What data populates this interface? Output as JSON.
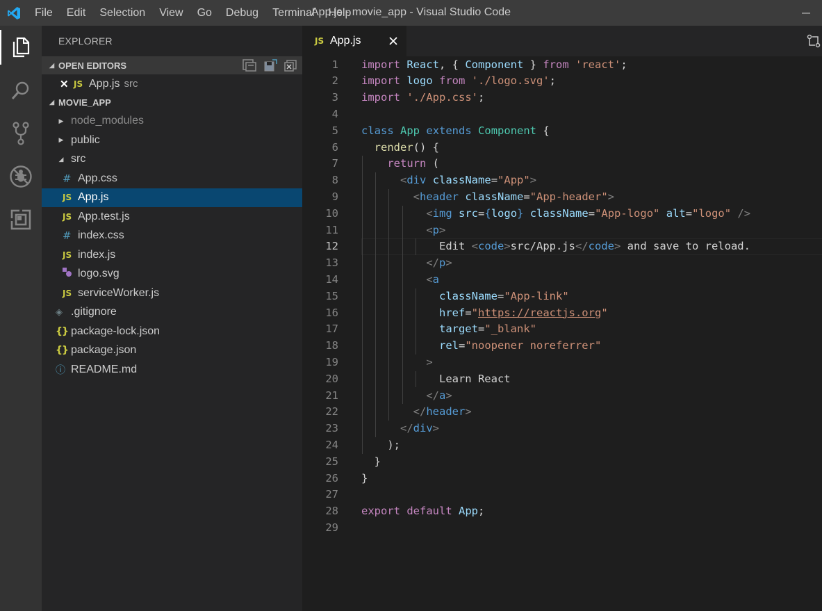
{
  "window": {
    "title": "App.js - movie_app - Visual Studio Code",
    "menu": [
      "File",
      "Edit",
      "Selection",
      "View",
      "Go",
      "Debug",
      "Terminal",
      "Help"
    ]
  },
  "activity_bar": {
    "items": [
      "explorer-icon",
      "search-icon",
      "source-control-icon",
      "debug-icon",
      "extensions-icon"
    ],
    "active": "explorer-icon"
  },
  "sidebar": {
    "title": "EXPLORER",
    "open_editors": {
      "label": "OPEN EDITORS",
      "items": [
        {
          "icon": "JS",
          "name": "App.js",
          "desc": "src"
        }
      ]
    },
    "project": {
      "label": "MOVIE_APP",
      "tree": [
        {
          "name": "node_modules",
          "kind": "folder",
          "expanded": false,
          "depth": 0
        },
        {
          "name": "public",
          "kind": "folder",
          "expanded": false,
          "depth": 0
        },
        {
          "name": "src",
          "kind": "folder",
          "expanded": true,
          "depth": 0
        },
        {
          "name": "App.css",
          "icon": "#",
          "depth": 1
        },
        {
          "name": "App.js",
          "icon": "JS",
          "depth": 1,
          "selected": true
        },
        {
          "name": "App.test.js",
          "icon": "JS",
          "depth": 1
        },
        {
          "name": "index.css",
          "icon": "#",
          "depth": 1
        },
        {
          "name": "index.js",
          "icon": "JS",
          "depth": 1
        },
        {
          "name": "logo.svg",
          "icon": "svg",
          "depth": 1
        },
        {
          "name": "serviceWorker.js",
          "icon": "JS",
          "depth": 1
        },
        {
          "name": ".gitignore",
          "icon": "git",
          "depth": 0
        },
        {
          "name": "package-lock.json",
          "icon": "{}",
          "depth": 0
        },
        {
          "name": "package.json",
          "icon": "{}",
          "depth": 0
        },
        {
          "name": "README.md",
          "icon": "i",
          "depth": 0
        }
      ]
    }
  },
  "tabs": [
    {
      "icon": "JS",
      "label": "App.js",
      "active": true
    }
  ],
  "editor": {
    "current_line": 12,
    "lines": [
      [
        [
          "kw",
          "import"
        ],
        [
          "txt",
          " "
        ],
        [
          "var",
          "React"
        ],
        [
          "txt",
          ", { "
        ],
        [
          "var",
          "Component"
        ],
        [
          "txt",
          " } "
        ],
        [
          "kw",
          "from"
        ],
        [
          "txt",
          " "
        ],
        [
          "str",
          "'react'"
        ],
        [
          "txt",
          ";"
        ]
      ],
      [
        [
          "kw",
          "import"
        ],
        [
          "txt",
          " "
        ],
        [
          "var",
          "logo"
        ],
        [
          "txt",
          " "
        ],
        [
          "kw",
          "from"
        ],
        [
          "txt",
          " "
        ],
        [
          "str",
          "'./logo.svg'"
        ],
        [
          "txt",
          ";"
        ]
      ],
      [
        [
          "kw",
          "import"
        ],
        [
          "txt",
          " "
        ],
        [
          "str",
          "'./App.css'"
        ],
        [
          "txt",
          ";"
        ]
      ],
      [],
      [
        [
          "kwb",
          "class"
        ],
        [
          "txt",
          " "
        ],
        [
          "cls",
          "App"
        ],
        [
          "txt",
          " "
        ],
        [
          "kwb",
          "extends"
        ],
        [
          "txt",
          " "
        ],
        [
          "cls",
          "Component"
        ],
        [
          "txt",
          " {"
        ]
      ],
      [
        [
          "txt",
          "  "
        ],
        [
          "fn",
          "render"
        ],
        [
          "txt",
          "() {"
        ]
      ],
      [
        [
          "txt",
          "    "
        ],
        [
          "kw",
          "return"
        ],
        [
          "txt",
          " ("
        ]
      ],
      [
        [
          "txt",
          "      "
        ],
        [
          "punc",
          "<"
        ],
        [
          "tag",
          "div"
        ],
        [
          "txt",
          " "
        ],
        [
          "attr",
          "className"
        ],
        [
          "txt",
          "="
        ],
        [
          "str",
          "\"App\""
        ],
        [
          "punc",
          ">"
        ]
      ],
      [
        [
          "txt",
          "        "
        ],
        [
          "punc",
          "<"
        ],
        [
          "tag",
          "header"
        ],
        [
          "txt",
          " "
        ],
        [
          "attr",
          "className"
        ],
        [
          "txt",
          "="
        ],
        [
          "str",
          "\"App-header\""
        ],
        [
          "punc",
          ">"
        ]
      ],
      [
        [
          "txt",
          "          "
        ],
        [
          "punc",
          "<"
        ],
        [
          "tag",
          "img"
        ],
        [
          "txt",
          " "
        ],
        [
          "attr",
          "src"
        ],
        [
          "txt",
          "="
        ],
        [
          "kwb",
          "{"
        ],
        [
          "var",
          "logo"
        ],
        [
          "kwb",
          "}"
        ],
        [
          "txt",
          " "
        ],
        [
          "attr",
          "className"
        ],
        [
          "txt",
          "="
        ],
        [
          "str",
          "\"App-logo\""
        ],
        [
          "txt",
          " "
        ],
        [
          "attr",
          "alt"
        ],
        [
          "txt",
          "="
        ],
        [
          "str",
          "\"logo\""
        ],
        [
          "txt",
          " "
        ],
        [
          "punc",
          "/>"
        ]
      ],
      [
        [
          "txt",
          "          "
        ],
        [
          "punc",
          "<"
        ],
        [
          "tag",
          "p"
        ],
        [
          "punc",
          ">"
        ]
      ],
      [
        [
          "txt",
          "            Edit "
        ],
        [
          "punc",
          "<"
        ],
        [
          "tag",
          "code"
        ],
        [
          "punc",
          ">"
        ],
        [
          "txt",
          "src/App.js"
        ],
        [
          "punc",
          "</"
        ],
        [
          "tag",
          "code"
        ],
        [
          "punc",
          ">"
        ],
        [
          "txt",
          " and save to reload."
        ]
      ],
      [
        [
          "txt",
          "          "
        ],
        [
          "punc",
          "</"
        ],
        [
          "tag",
          "p"
        ],
        [
          "punc",
          ">"
        ]
      ],
      [
        [
          "txt",
          "          "
        ],
        [
          "punc",
          "<"
        ],
        [
          "tag",
          "a"
        ]
      ],
      [
        [
          "txt",
          "            "
        ],
        [
          "attr",
          "className"
        ],
        [
          "txt",
          "="
        ],
        [
          "str",
          "\"App-link\""
        ]
      ],
      [
        [
          "txt",
          "            "
        ],
        [
          "attr",
          "href"
        ],
        [
          "txt",
          "="
        ],
        [
          "str",
          "\""
        ],
        [
          "str url",
          "https://reactjs.org"
        ],
        [
          "str",
          "\""
        ]
      ],
      [
        [
          "txt",
          "            "
        ],
        [
          "attr",
          "target"
        ],
        [
          "txt",
          "="
        ],
        [
          "str",
          "\"_blank\""
        ]
      ],
      [
        [
          "txt",
          "            "
        ],
        [
          "attr",
          "rel"
        ],
        [
          "txt",
          "="
        ],
        [
          "str",
          "\"noopener noreferrer\""
        ]
      ],
      [
        [
          "txt",
          "          "
        ],
        [
          "punc",
          ">"
        ]
      ],
      [
        [
          "txt",
          "            Learn React"
        ]
      ],
      [
        [
          "txt",
          "          "
        ],
        [
          "punc",
          "</"
        ],
        [
          "tag",
          "a"
        ],
        [
          "punc",
          ">"
        ]
      ],
      [
        [
          "txt",
          "        "
        ],
        [
          "punc",
          "</"
        ],
        [
          "tag",
          "header"
        ],
        [
          "punc",
          ">"
        ]
      ],
      [
        [
          "txt",
          "      "
        ],
        [
          "punc",
          "</"
        ],
        [
          "tag",
          "div"
        ],
        [
          "punc",
          ">"
        ]
      ],
      [
        [
          "txt",
          "    );"
        ]
      ],
      [
        [
          "txt",
          "  }"
        ]
      ],
      [
        [
          "txt",
          "}"
        ]
      ],
      [],
      [
        [
          "kw",
          "export"
        ],
        [
          "txt",
          " "
        ],
        [
          "kw",
          "default"
        ],
        [
          "txt",
          " "
        ],
        [
          "var",
          "App"
        ],
        [
          "txt",
          ";"
        ]
      ],
      []
    ]
  },
  "colors": {
    "titlebar": "#3c3c3c",
    "activitybar": "#333333",
    "sidebar": "#252526",
    "editor": "#1e1e1e",
    "selection": "#094771",
    "vscode_blue": "#23a9f2"
  }
}
